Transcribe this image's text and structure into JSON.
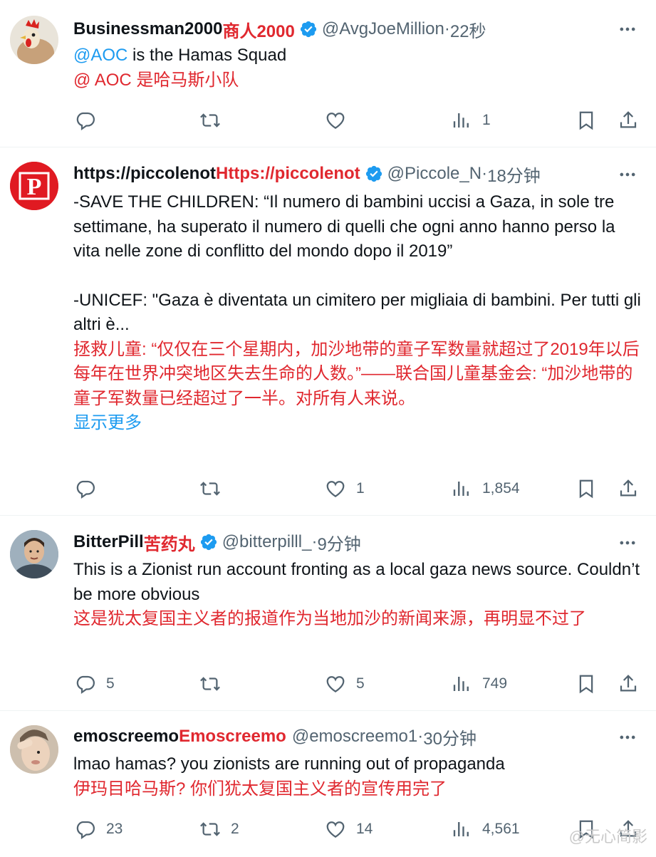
{
  "tweets": [
    {
      "name": "Businessman2000",
      "name_tr": "商人2000",
      "handle": "@AvgJoeMillion",
      "sep": " · ",
      "time": "22秒",
      "mention": "@AOC",
      "text_rest": " is the Hamas Squad",
      "text_tr": "@ AOC 是哈马斯小队",
      "replies": "",
      "retweets": "",
      "likes": "",
      "views": "1"
    },
    {
      "name": "https://piccolenot",
      "name_tr": "Https://piccolenot",
      "handle": "@Piccole_N",
      "sep": "· ",
      "time": "18分钟",
      "p1": "-SAVE THE CHILDREN: “Il numero di bambini uccisi a Gaza, in sole tre settimane, ha superato il numero di quelli che ogni anno hanno perso la vita nelle zone di conflitto del mondo dopo il 2019”",
      "p2": "-UNICEF: \"Gaza è diventata un cimitero per migliaia di bambini. Per tutti gli altri è...",
      "text_tr": "拯救儿童: “仅仅在三个星期内，加沙地带的童子军数量就超过了2019年以后每年在世界冲突地区失去生命的人数。”——联合国儿童基金会: “加沙地带的童子军数量已经超过了一半。对所有人来说。",
      "show_more": "显示更多",
      "replies": "",
      "retweets": "",
      "likes": "1",
      "views": "1,854"
    },
    {
      "name": "BitterPill",
      "name_tr": "苦药丸",
      "handle": "@bitterpilll_",
      "sep": " · ",
      "time": "9分钟",
      "text": "This is a Zionist run account fronting as a local gaza news source. Couldn’t be more obvious",
      "text_tr": "这是犹太复国主义者的报道作为当地加沙的新闻来源，再明显不过了",
      "replies": "5",
      "retweets": "",
      "likes": "5",
      "views": "749"
    },
    {
      "name": "emoscreemo",
      "name_tr": "Emoscreemo",
      "handle": "@emoscreemo1",
      "sep": " · ",
      "time": "30分钟",
      "text": "lmao hamas? you zionists are running out of propaganda",
      "text_tr": "伊玛目哈马斯? 你们犹太复国主义者的宣传用完了",
      "replies": "23",
      "retweets": "2",
      "likes": "14",
      "views": "4,561"
    }
  ],
  "watermark": "@无心简影",
  "icons": [
    "more-icon",
    "reply-icon",
    "retweet-icon",
    "like-icon",
    "views-icon",
    "bookmark-icon",
    "share-icon",
    "verified-icon"
  ],
  "colors": {
    "verified": "#1d9bf0",
    "link": "#1d9bf0",
    "translation": "#e0282f",
    "muted": "#536471"
  }
}
